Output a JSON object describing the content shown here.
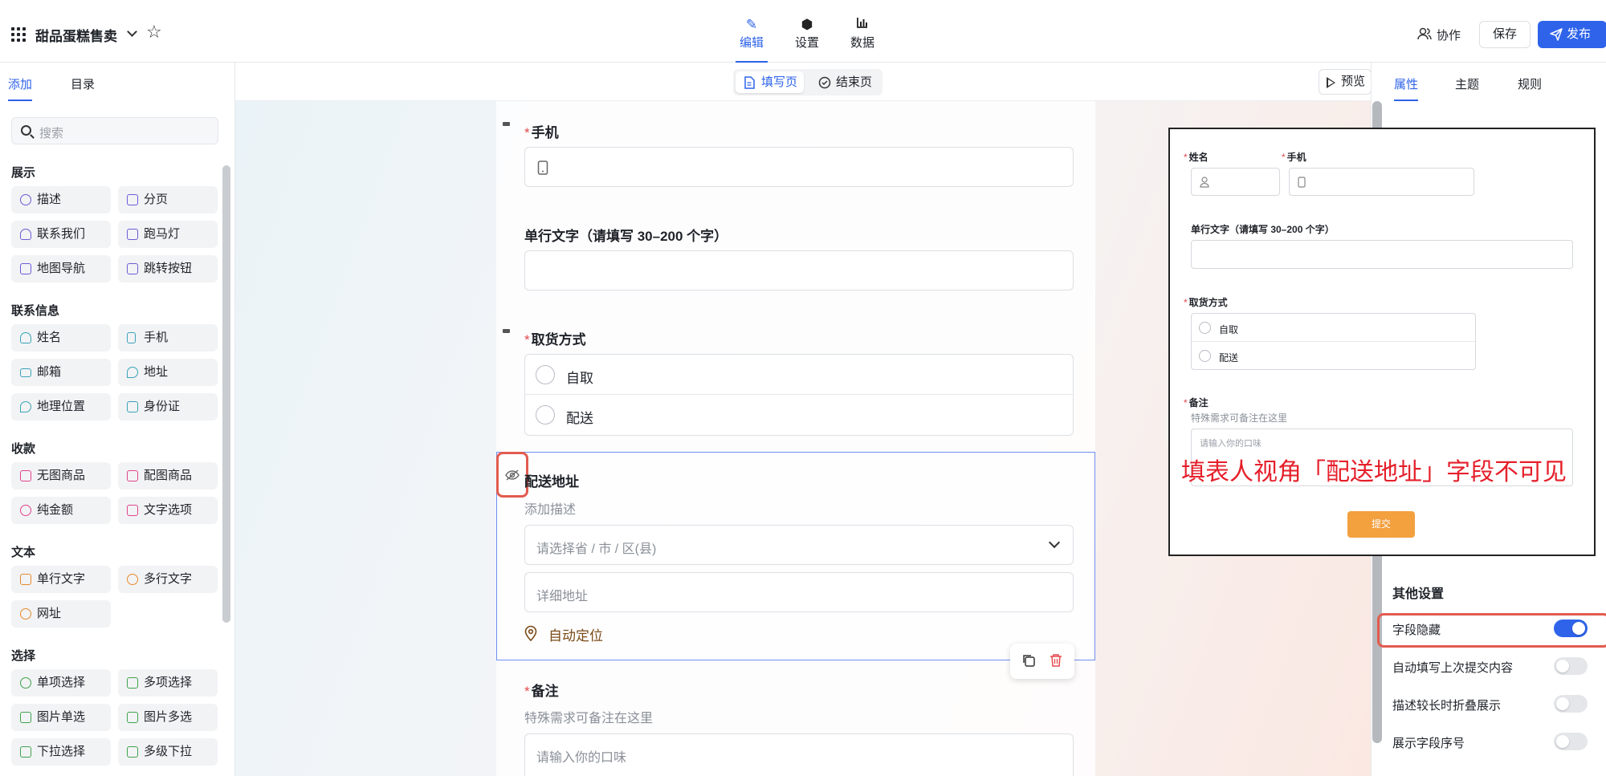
{
  "app": {
    "title": "甜品蛋糕售卖"
  },
  "main_tabs": [
    {
      "label": "编辑",
      "icon": "pen-icon"
    },
    {
      "label": "设置",
      "icon": "hexagon-gear-icon"
    },
    {
      "label": "数据",
      "icon": "bar-chart-icon"
    }
  ],
  "header": {
    "collab_label": "协作",
    "save_label": "保存",
    "publish_label": "发布"
  },
  "left_panel": {
    "tabs": [
      "添加",
      "目录"
    ],
    "search_placeholder": "搜索",
    "categories": [
      {
        "name": "展示",
        "items": [
          {
            "label": "描述",
            "color": "#6b5bd6"
          },
          {
            "label": "分页",
            "color": "#6b5bd6"
          },
          {
            "label": "联系我们",
            "color": "#6b5bd6"
          },
          {
            "label": "跑马灯",
            "color": "#6b5bd6"
          },
          {
            "label": "地图导航",
            "color": "#6b5bd6"
          },
          {
            "label": "跳转按钮",
            "color": "#6b5bd6"
          }
        ]
      },
      {
        "name": "联系信息",
        "items": [
          {
            "label": "姓名",
            "color": "#3aa3b8"
          },
          {
            "label": "手机",
            "color": "#3aa3b8"
          },
          {
            "label": "邮箱",
            "color": "#3aa3b8"
          },
          {
            "label": "地址",
            "color": "#3aa3b8"
          },
          {
            "label": "地理位置",
            "color": "#3aa3b8"
          },
          {
            "label": "身份证",
            "color": "#3aa3b8"
          }
        ]
      },
      {
        "name": "收款",
        "items": [
          {
            "label": "无图商品",
            "color": "#e0448c"
          },
          {
            "label": "配图商品",
            "color": "#e0448c"
          },
          {
            "label": "纯金额",
            "color": "#e0448c"
          },
          {
            "label": "文字选项",
            "color": "#e0448c"
          }
        ]
      },
      {
        "name": "文本",
        "items": [
          {
            "label": "单行文字",
            "color": "#e58a2e"
          },
          {
            "label": "多行文字",
            "color": "#e58a2e"
          },
          {
            "label": "网址",
            "color": "#e58a2e"
          }
        ]
      },
      {
        "name": "选择",
        "items": [
          {
            "label": "单项选择",
            "color": "#3fa34d"
          },
          {
            "label": "多项选择",
            "color": "#3fa34d"
          },
          {
            "label": "图片单选",
            "color": "#3fa34d"
          },
          {
            "label": "图片多选",
            "color": "#3fa34d"
          },
          {
            "label": "下拉选择",
            "color": "#3fa34d"
          },
          {
            "label": "多级下拉",
            "color": "#3fa34d"
          }
        ]
      }
    ]
  },
  "toolbar": {
    "fill_page": "填写页",
    "end_page": "结束页",
    "preview": "预览"
  },
  "form": {
    "phone": {
      "label": "手机"
    },
    "single_text": {
      "label": "单行文字（请填写 30–200 个字）"
    },
    "pickup": {
      "label": "取货方式",
      "options": [
        "自取",
        "配送"
      ]
    },
    "delivery": {
      "label": "配送地址",
      "description": "添加描述",
      "region_placeholder": "请选择省 / 市 / 区(县)",
      "detail_placeholder": "详细地址",
      "locate": "自动定位"
    },
    "remark": {
      "label": "备注",
      "description": "特殊需求可备注在这里",
      "placeholder": "请输入你的口味"
    }
  },
  "right_panel": {
    "tabs": [
      "属性",
      "主题",
      "规则"
    ],
    "section_title": "其他设置",
    "settings": [
      {
        "label": "字段隐藏",
        "on": true
      },
      {
        "label": "自动填写上次提交内容",
        "on": false
      },
      {
        "label": "描述较长时折叠展示",
        "on": false
      },
      {
        "label": "展示字段序号",
        "on": false
      }
    ]
  },
  "overlay": {
    "name_label": "姓名",
    "phone_label": "手机",
    "single_text_label": "单行文字（请填写 30–200 个字）",
    "pickup_label": "取货方式",
    "options": [
      "自取",
      "配送"
    ],
    "remark_label": "备注",
    "remark_desc": "特殊需求可备注在这里",
    "remark_placeholder": "请输入你的口味",
    "note": "填表人视角「配送地址」字段不可见",
    "submit": "提交"
  },
  "colors": {
    "accent": "#2e63ea",
    "highlight": "#e25c4f",
    "required": "#e5484d",
    "submit": "#f3a03f"
  }
}
